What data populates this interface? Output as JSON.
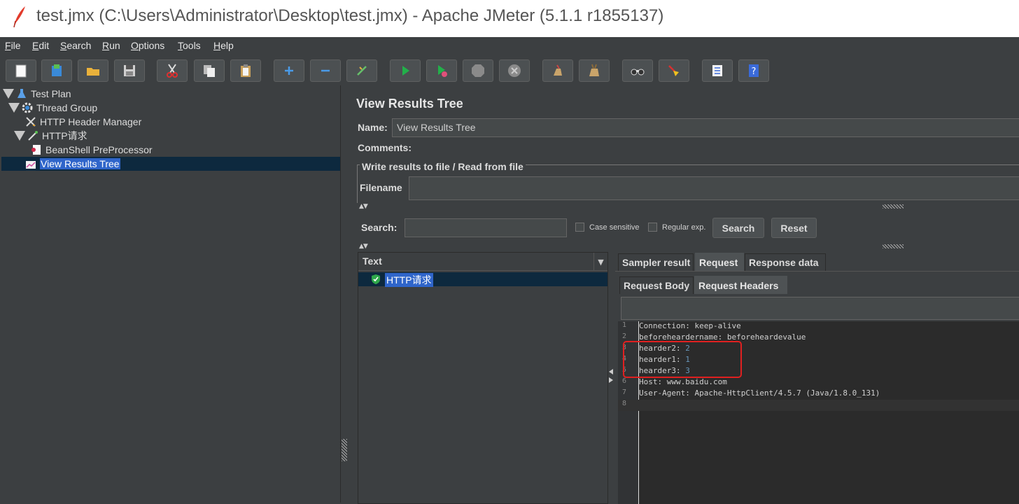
{
  "window": {
    "title": "test.jmx (C:\\Users\\Administrator\\Desktop\\test.jmx) - Apache JMeter (5.1.1 r1855137)",
    "app_icon": "feather-icon"
  },
  "menu": {
    "file": "File",
    "edit": "Edit",
    "search": "Search",
    "run": "Run",
    "options": "Options",
    "tools": "Tools",
    "help": "Help"
  },
  "toolbar": {
    "buttons": [
      "new-icon",
      "templates-icon",
      "open-icon",
      "save-icon",
      "cut-icon",
      "copy-icon",
      "paste-icon",
      "expand-icon",
      "collapse-icon",
      "toggle-icon",
      "start-icon",
      "start-no-pause-icon",
      "stop-icon",
      "shutdown-icon",
      "clear-icon",
      "clear-all-icon",
      "search-icon",
      "reset-search-icon",
      "function-helper-icon",
      "help-icon"
    ]
  },
  "tree": {
    "items": [
      {
        "label": "Test Plan",
        "icon": "flask-icon"
      },
      {
        "label": "Thread Group",
        "icon": "gear-icon"
      },
      {
        "label": "HTTP Header Manager",
        "icon": "tools-icon"
      },
      {
        "label": "HTTP请求",
        "icon": "pipette-icon"
      },
      {
        "label": "BeanShell PreProcessor",
        "icon": "document-icon"
      },
      {
        "label": "View Results Tree",
        "icon": "chart-icon",
        "selected": true
      }
    ]
  },
  "panel": {
    "title": "View Results Tree",
    "name_label": "Name:",
    "name_value": "View Results Tree",
    "comments_label": "Comments:",
    "fieldset_legend": "Write results to file / Read from file",
    "filename_label": "Filename",
    "filename_value": ""
  },
  "search": {
    "label": "Search:",
    "value": "",
    "case_sensitive": "Case sensitive",
    "regex": "Regular exp.",
    "search_button": "Search",
    "reset_button": "Reset"
  },
  "results": {
    "renderer": "Text",
    "samples": [
      {
        "label": "HTTP请求",
        "status": "success"
      }
    ]
  },
  "tabs": {
    "main": [
      "Sampler result",
      "Request",
      "Response data"
    ],
    "main_active": "Request",
    "sub": [
      "Request Body",
      "Request Headers"
    ],
    "sub_active": "Request Headers"
  },
  "headers": {
    "lines": [
      {
        "n": "1",
        "key": "Connection: ",
        "val": "keep-alive"
      },
      {
        "n": "2",
        "key": "beforeheardername: ",
        "val": "beforeheardevalue"
      },
      {
        "n": "3",
        "key": "hearder2: ",
        "val": "2"
      },
      {
        "n": "4",
        "key": "hearder1: ",
        "val": "1"
      },
      {
        "n": "5",
        "key": "hearder3: ",
        "val": "3"
      },
      {
        "n": "6",
        "key": "Host: ",
        "val": "www.baidu.com"
      },
      {
        "n": "7",
        "key": "User-Agent: ",
        "val": "Apache-HttpClient/4.5.7 (Java/1.8.0_131)"
      },
      {
        "n": "8",
        "key": "",
        "val": ""
      }
    ]
  },
  "colors": {
    "background": "#3c3f41",
    "selection": "#2f65ca",
    "annotation": "#e02020"
  }
}
